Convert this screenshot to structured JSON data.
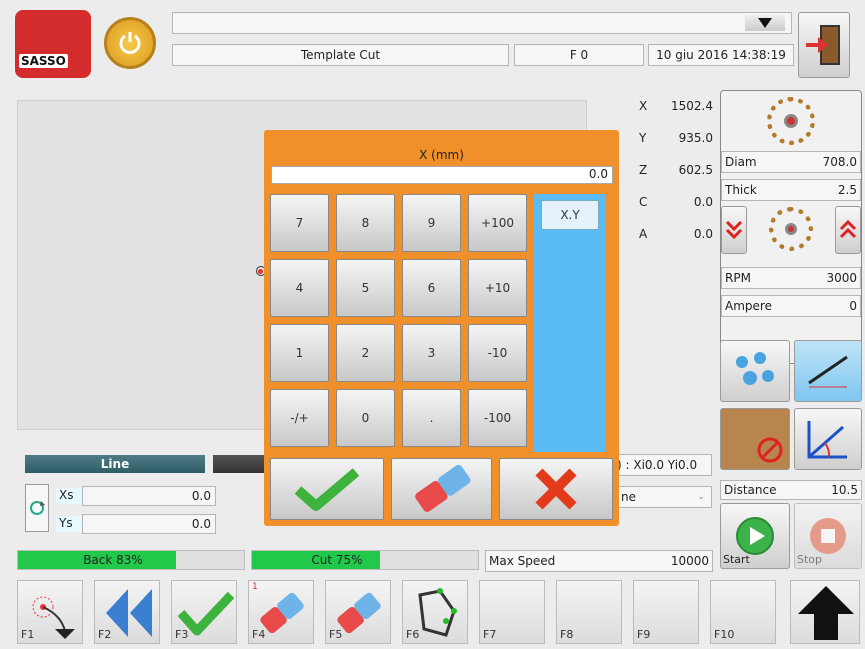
{
  "header": {
    "mode": "Template Cut",
    "feed": "F 0",
    "datetime": "10 giu 2016 14:38:19",
    "logo": "SASSO"
  },
  "coords": [
    {
      "axis": "X",
      "value": "1502.4"
    },
    {
      "axis": "Y",
      "value": "935.0"
    },
    {
      "axis": "Z",
      "value": "602.5"
    },
    {
      "axis": "C",
      "value": "0.0"
    },
    {
      "axis": "A",
      "value": "0.0"
    }
  ],
  "blade": {
    "diam_label": "Diam",
    "diam_value": "708.0",
    "thick_label": "Thick",
    "thick_value": "2.5",
    "rpm_label": "RPM",
    "rpm_value": "3000",
    "ampere_label": "Ampere",
    "ampere_value": "0"
  },
  "distance": {
    "label": "Distance",
    "value": "10.5"
  },
  "start_label": "Start",
  "stop_label": "Stop",
  "line_tab": "Line",
  "xi_text": ") : Xi0.0 Yi0.0",
  "xs": {
    "label": "Xs",
    "value": "0.0"
  },
  "ys": {
    "label": "Ys",
    "value": "0.0"
  },
  "partial_select": "ne",
  "back_progress": {
    "label": "Back 83%",
    "value": 83
  },
  "cut_progress": {
    "label": "Cut 75%",
    "value": 75
  },
  "max_speed": {
    "label": "Max Speed",
    "value": "10000"
  },
  "fkeys": [
    "F1",
    "F2",
    "F3",
    "F4",
    "F5",
    "F6",
    "F7",
    "F8",
    "F9",
    "F10"
  ],
  "f4_small": "1",
  "keypad": {
    "title": "X (mm)",
    "display": "0.0",
    "keys": [
      [
        "7",
        "8",
        "9",
        "+100"
      ],
      [
        "4",
        "5",
        "6",
        "+10"
      ],
      [
        "1",
        "2",
        "3",
        "-10"
      ],
      [
        "-/+",
        "0",
        ".",
        "-100"
      ]
    ],
    "side_key": "X.Y"
  },
  "colors": {
    "keypad_orange": "#f0902a",
    "side_blue": "#5bbcf5",
    "progress_green": "#22c84a",
    "accent_teal": "#2f5d66"
  }
}
